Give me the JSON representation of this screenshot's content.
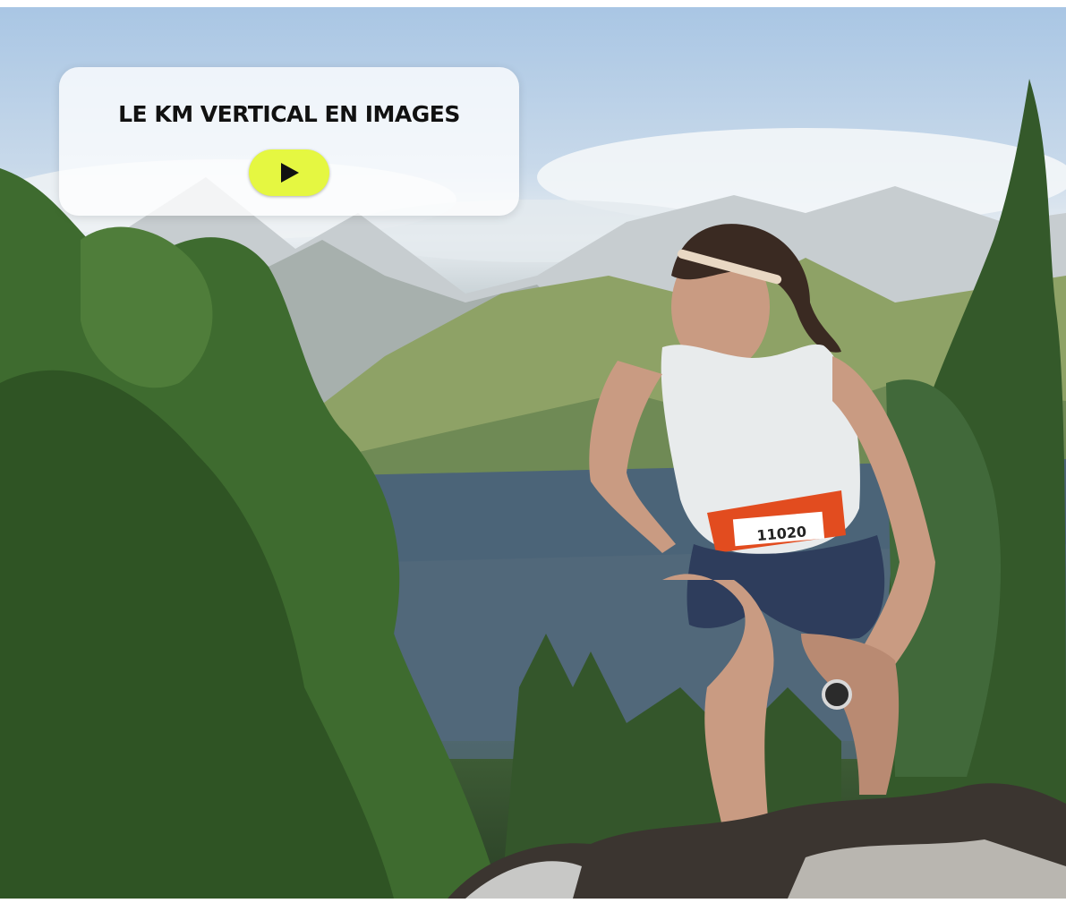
{
  "hero": {
    "title": "LE KM VERTICAL EN IMAGES",
    "play_icon": "play-icon",
    "bib_number": "11020",
    "accent_color": "#e5f741"
  }
}
